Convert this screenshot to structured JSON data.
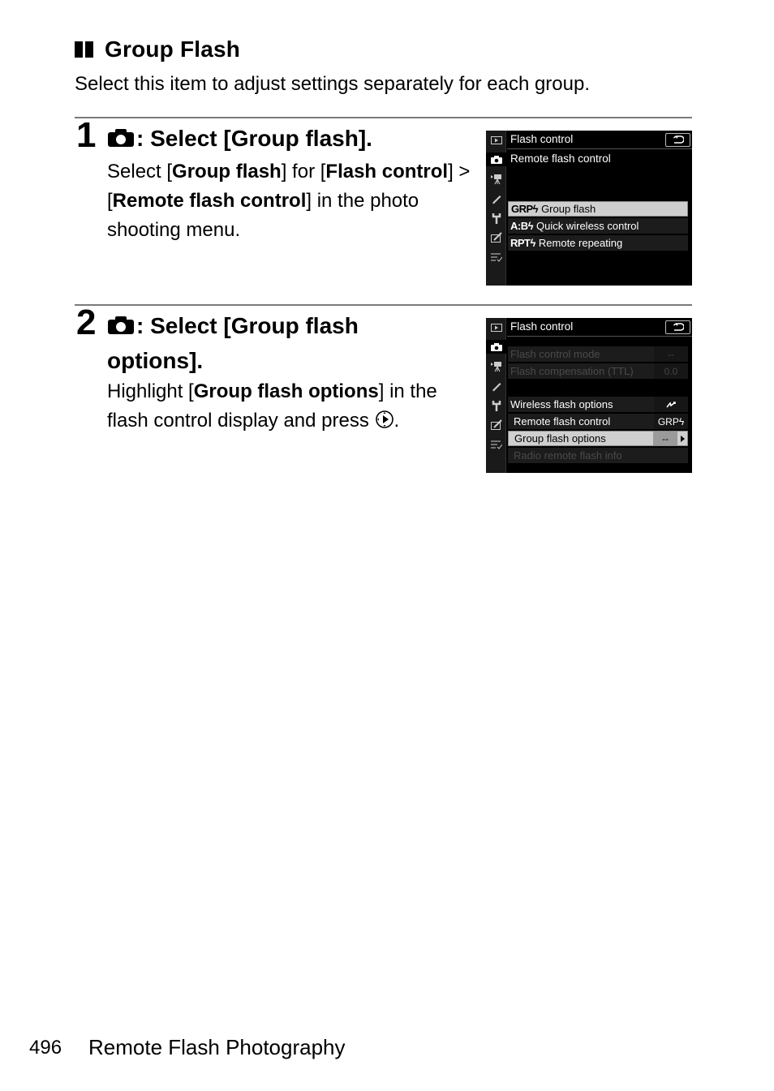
{
  "section": {
    "title": "Group Flash",
    "description": "Select this item to adjust settings separately for each group."
  },
  "steps": [
    {
      "number": "1",
      "icon": "camera-icon",
      "title": ": Select [Group flash].",
      "body": [
        {
          "text": "Select [",
          "bold": false
        },
        {
          "text": "Group flash",
          "bold": true
        },
        {
          "text": "] for [",
          "bold": false
        },
        {
          "text": "Flash control",
          "bold": true
        },
        {
          "text": "] > [",
          "bold": false
        },
        {
          "text": "Remote flash control",
          "bold": true
        },
        {
          "text": "] in the photo shooting menu.",
          "bold": false
        }
      ],
      "screen": {
        "title": "Flash control",
        "subtitle": "Remote flash control",
        "items": [
          {
            "prefix": "GRPϟ",
            "label": "Group flash",
            "selected": true
          },
          {
            "prefix": "A:Bϟ",
            "label": "Quick wireless control",
            "selected": false
          },
          {
            "prefix": "RPTϟ",
            "label": "Remote repeating",
            "selected": false
          }
        ]
      }
    },
    {
      "number": "2",
      "icon": "camera-icon",
      "title_line1": ": Select [Group flash",
      "title_line2": "options].",
      "body": [
        {
          "text": "Highlight [",
          "bold": false
        },
        {
          "text": "Group flash options",
          "bold": true
        },
        {
          "text": "] in the flash control display and press ",
          "bold": false
        },
        {
          "text": ".",
          "bold": false
        }
      ],
      "screen": {
        "title": "Flash control",
        "items": [
          {
            "label": "Flash control mode",
            "value": "--",
            "dim": true
          },
          {
            "label": "Flash compensation (TTL)",
            "value": "0.0",
            "dim": true
          },
          {
            "label": "Wireless flash options",
            "value": "wireless-icon",
            "dim": false
          },
          {
            "label": "Remote flash control",
            "value": "GRPϟ",
            "dim": false
          },
          {
            "label": "Group flash options",
            "value": "--",
            "selected": true
          },
          {
            "label": "Radio remote flash info",
            "value": "",
            "dim": true
          }
        ]
      }
    }
  ],
  "footer": {
    "page_number": "496",
    "chapter_title": "Remote Flash Photography"
  }
}
